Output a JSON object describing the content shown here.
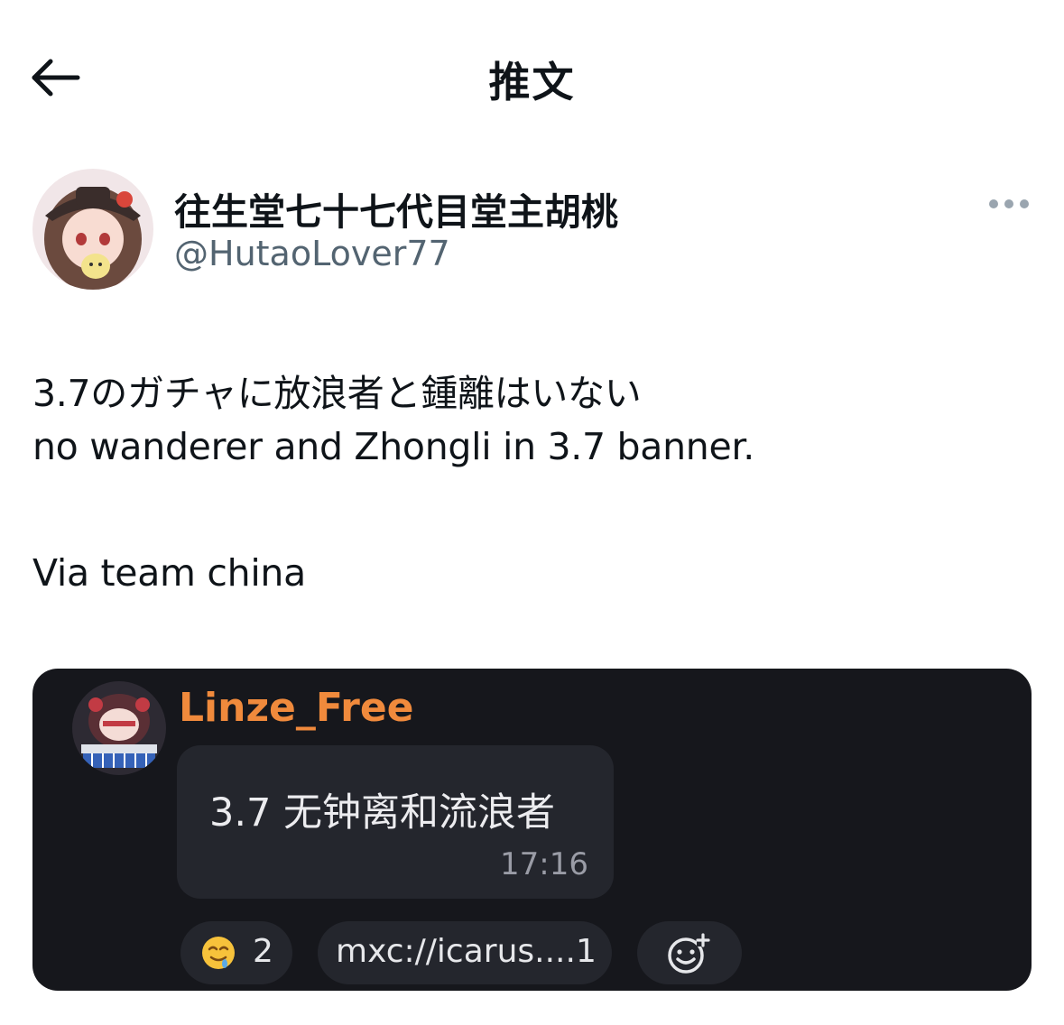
{
  "header": {
    "title": "推文"
  },
  "tweet": {
    "author": {
      "display_name": "往生堂七十七代目堂主胡桃",
      "handle": "@HutaoLover77"
    },
    "text_lines": [
      "3.7のガチャに放浪者と鍾離はいない",
      "no wanderer and Zhongli in 3.7 banner.",
      "Via team china"
    ]
  },
  "embedded_card": {
    "sender": "Linze_Free",
    "message": "3.7 无钟离和流浪者",
    "time": "17:16",
    "reactions": [
      {
        "icon": "drooling-face-emoji",
        "count": "2"
      },
      {
        "label": "mxc://icarus....",
        "count": "1"
      }
    ],
    "add_reaction_icon": "add-reaction-icon"
  },
  "colors": {
    "card_background": "#16171c",
    "bubble_background": "#24262d",
    "sender_accent": "#f08a3c",
    "handle_gray": "#536471"
  }
}
